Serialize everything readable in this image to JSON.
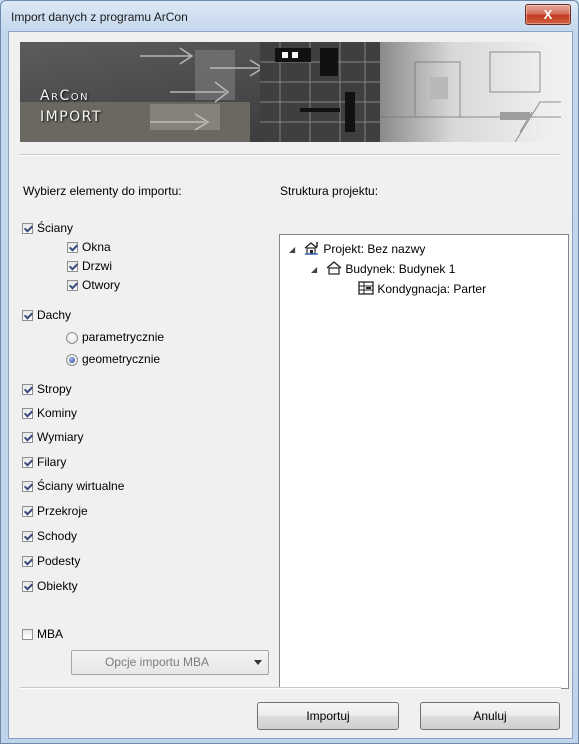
{
  "window": {
    "title": "Import danych z programu ArCon",
    "close_glyph": "X"
  },
  "banner": {
    "line1": "ArCon",
    "line2": "IMPORT"
  },
  "left_panel": {
    "heading": "Wybierz elementy do importu:",
    "items": {
      "sciany": {
        "label": "Ściany",
        "checked": true
      },
      "okna": {
        "label": "Okna",
        "checked": true
      },
      "drzwi": {
        "label": "Drzwi",
        "checked": true
      },
      "otwory": {
        "label": "Otwory",
        "checked": true
      },
      "dachy": {
        "label": "Dachy",
        "checked": true
      },
      "parametrycznie": {
        "label": "parametrycznie",
        "selected": false
      },
      "geometrycznie": {
        "label": "geometrycznie",
        "selected": true
      },
      "stropy": {
        "label": "Stropy",
        "checked": true
      },
      "kominy": {
        "label": "Kominy",
        "checked": true
      },
      "wymiary": {
        "label": "Wymiary",
        "checked": true
      },
      "filary": {
        "label": "Filary",
        "checked": true
      },
      "sciany_wirtualne": {
        "label": "Ściany wirtualne",
        "checked": true
      },
      "przekroje": {
        "label": "Przekroje",
        "checked": true
      },
      "schody": {
        "label": "Schody",
        "checked": true
      },
      "podesty": {
        "label": "Podesty",
        "checked": true
      },
      "obiekty": {
        "label": "Obiekty",
        "checked": true
      },
      "mba": {
        "label": "MBA",
        "checked": false
      }
    },
    "mba_options_combo": "Opcje importu MBA"
  },
  "right_panel": {
    "heading": "Struktura projektu:",
    "tree": {
      "project": "Projekt: Bez nazwy",
      "building": "Budynek: Budynek 1",
      "storey": "Kondygnacja: Parter"
    }
  },
  "buttons": {
    "import": "Importuj",
    "cancel": "Anuluj"
  },
  "icons": [
    "close-icon",
    "expand-triangle-icon",
    "project-icon",
    "building-icon",
    "storey-icon",
    "dropdown-arrow-icon"
  ],
  "colors": {
    "titlebar": "#c4d7ec",
    "close_button": "#c13b22",
    "client_background": "#f0f0f0"
  }
}
